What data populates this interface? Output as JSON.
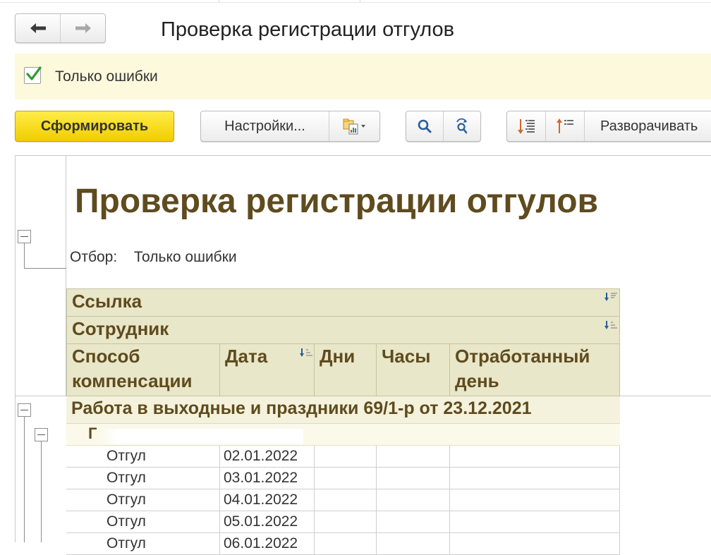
{
  "window": {
    "title": "Проверка регистрации отгулов"
  },
  "filter": {
    "only_errors_label": "Только ошибки",
    "checked": true
  },
  "toolbar": {
    "generate_label": "Сформировать",
    "settings_label": "Настройки...",
    "expand_label": "Разворачивать"
  },
  "report": {
    "title": "Проверка регистрации отгулов",
    "filter_prefix": "Отбор:",
    "filter_value": "Только ошибки",
    "headers": {
      "link": "Ссылка",
      "employee": "Сотрудник",
      "method_line1": "Способ",
      "method_line2": "компенсации",
      "date": "Дата",
      "days": "Дни",
      "hours": "Часы",
      "worked_line1": "Отработанный",
      "worked_line2": "день"
    },
    "group_title": "Работа в выходные и праздники 69/1-р от 23.12.2021",
    "subgroup_partial": "Г",
    "rows": [
      {
        "method": "Отгул",
        "date": "02.01.2022"
      },
      {
        "method": "Отгул",
        "date": "03.01.2022"
      },
      {
        "method": "Отгул",
        "date": "04.01.2022"
      },
      {
        "method": "Отгул",
        "date": "05.01.2022"
      },
      {
        "method": "Отгул",
        "date": "06.01.2022"
      }
    ]
  },
  "colors": {
    "primary_button": "#f2cd00",
    "header_bg": "#e9e7c9",
    "title_text": "#5f4b1e",
    "filter_bg": "#fdf9dc"
  }
}
